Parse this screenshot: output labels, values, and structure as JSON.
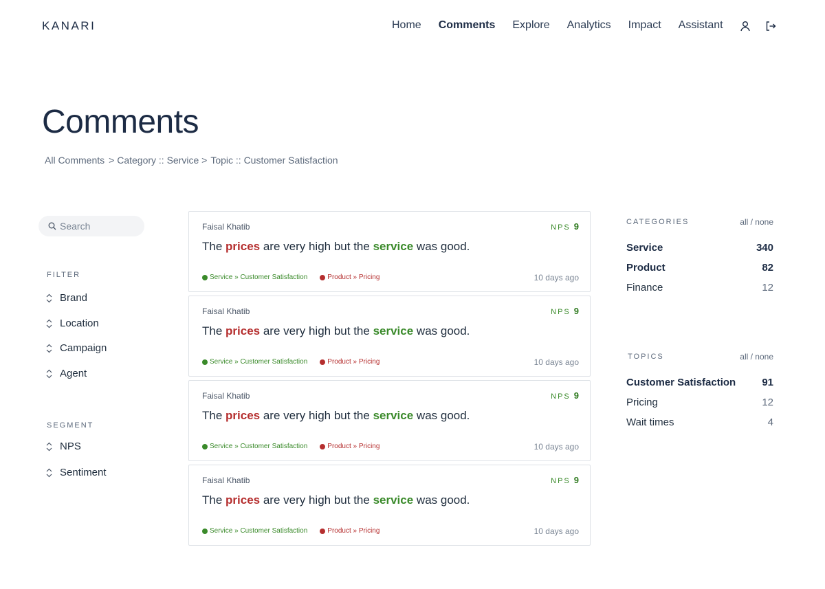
{
  "header": {
    "logo": "KANARI",
    "nav": [
      "Home",
      "Comments",
      "Explore",
      "Analytics",
      "Impact",
      "Assistant"
    ],
    "active_nav": "Comments"
  },
  "page": {
    "title": "Comments",
    "breadcrumb": [
      "All Comments",
      "> Category :: Service >",
      "Topic :: Customer Satisfaction"
    ]
  },
  "sidebar": {
    "search_placeholder": "Search",
    "filter_label": "FILTER",
    "filters": [
      "Brand",
      "Location",
      "Campaign",
      "Agent"
    ],
    "segment_label": "SEGMENT",
    "segments": [
      "NPS",
      "Sentiment"
    ]
  },
  "comments": [
    {
      "author": "Faisal Khatib",
      "nps_label": "NPS",
      "nps": "9",
      "text_a": "The ",
      "neg_word": "prices",
      "text_b": " are very high but the ",
      "pos_word": "service",
      "text_c": " was good.",
      "tag_green": "Service » Customer Satisfaction",
      "tag_red": "Product » Pricing",
      "time": "10 days ago"
    },
    {
      "author": "Faisal Khatib",
      "nps_label": "NPS",
      "nps": "9",
      "text_a": "The ",
      "neg_word": "prices",
      "text_b": " are very high but the ",
      "pos_word": "service",
      "text_c": " was good.",
      "tag_green": "Service » Customer Satisfaction",
      "tag_red": "Product » Pricing",
      "time": "10 days ago"
    },
    {
      "author": "Faisal Khatib",
      "nps_label": "NPS",
      "nps": "9",
      "text_a": "The ",
      "neg_word": "prices",
      "text_b": " are very high but the ",
      "pos_word": "service",
      "text_c": " was good.",
      "tag_green": "Service » Customer Satisfaction",
      "tag_red": "Product » Pricing",
      "time": "10 days ago"
    },
    {
      "author": "Faisal Khatib",
      "nps_label": "NPS",
      "nps": "9",
      "text_a": "The ",
      "neg_word": "prices",
      "text_b": " are very high but the ",
      "pos_word": "service",
      "text_c": " was good.",
      "tag_green": "Service » Customer Satisfaction",
      "tag_red": "Product » Pricing",
      "time": "10 days ago"
    }
  ],
  "categories": {
    "label": "CATEGORIES",
    "toggle": "all / none",
    "items": [
      {
        "name": "Service",
        "count": "340",
        "bold": true
      },
      {
        "name": "Product",
        "count": "82",
        "bold": true
      },
      {
        "name": "Finance",
        "count": "12",
        "bold": false
      }
    ]
  },
  "topics": {
    "label": "TOPICS",
    "toggle": "all / none",
    "items": [
      {
        "name": "Customer Satisfaction",
        "count": "91",
        "bold": true
      },
      {
        "name": "Pricing",
        "count": "12",
        "bold": false
      },
      {
        "name": "Wait times",
        "count": "4",
        "bold": false
      }
    ]
  },
  "colors": {
    "positive": "#3a8a2a",
    "negative": "#b52e2e",
    "text": "#1f2d3d"
  }
}
